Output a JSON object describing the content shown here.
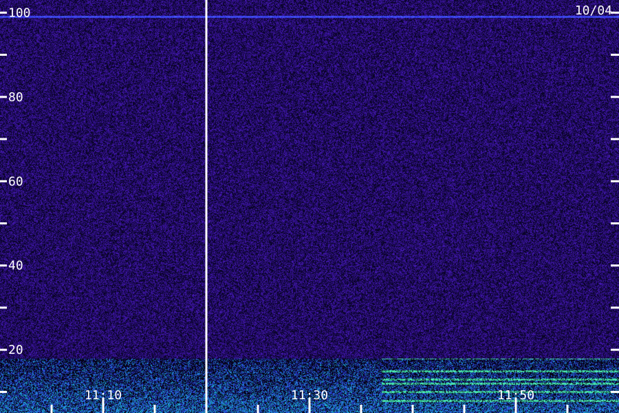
{
  "chart_data": {
    "type": "heatmap",
    "date_label": "10/04",
    "y_axis": {
      "ticks": [
        100,
        80,
        60,
        40,
        20
      ],
      "minor_ticks": [
        90,
        70,
        50,
        30,
        10
      ],
      "range": [
        5,
        103
      ]
    },
    "x_axis": {
      "ticks": [
        "11:10",
        "11:30",
        "11:50"
      ],
      "tick_times_min": [
        10,
        30,
        50
      ],
      "minor_tick_times_min": [
        5,
        15,
        20,
        25,
        35,
        40,
        45,
        55
      ],
      "range_min": [
        0,
        60
      ]
    },
    "data_gap_time_min": 20,
    "features": {
      "constant_line_value": 99,
      "low_band_upper_value": 18,
      "bright_lines_start_min": 37,
      "bright_line_values": [
        18,
        15,
        13,
        12,
        10,
        8
      ]
    },
    "colors": {
      "background": "#1e0a5a",
      "noise_low": "#2a0e78",
      "noise_high": "#4a1aa8",
      "line_blue": "#3a3aff",
      "hot_cyan": "#28e6b4",
      "hot_green": "#5aff8a",
      "axis": "#ffffff"
    }
  }
}
